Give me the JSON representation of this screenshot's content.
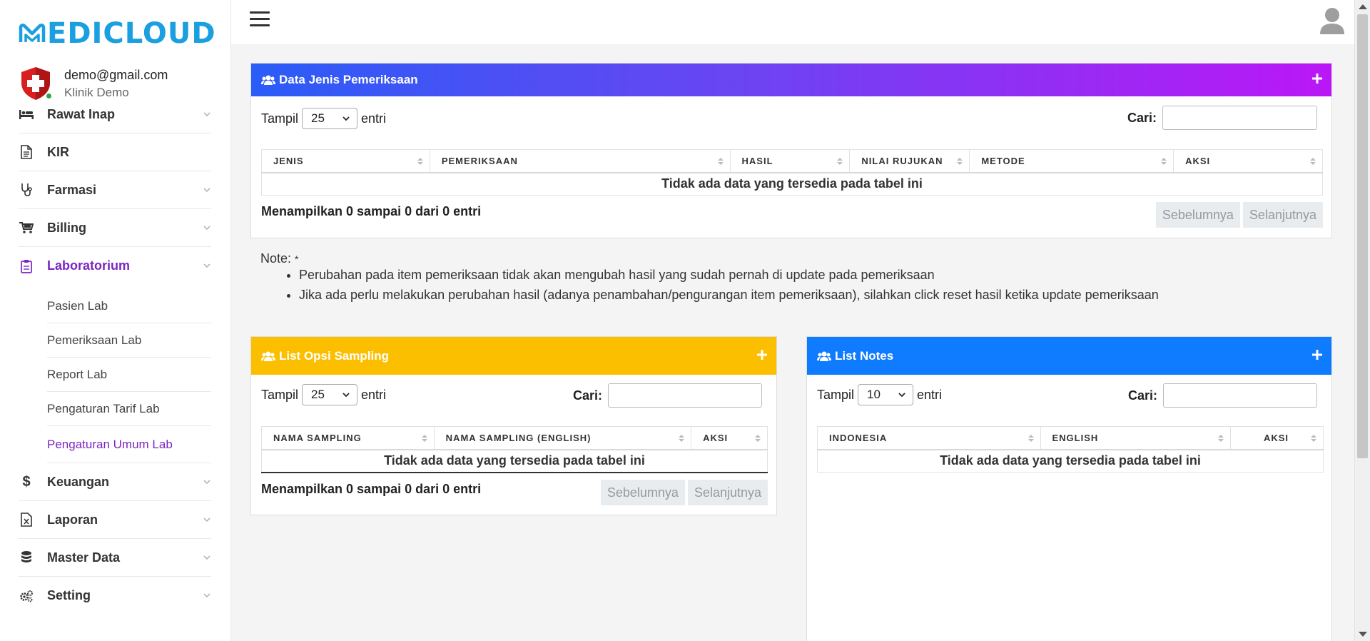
{
  "brand": {
    "logo_text": "EDICLOUD",
    "color": "#1a9fe0"
  },
  "user": {
    "email": "demo@gmail.com",
    "clinic": "Klinik Demo"
  },
  "sidebar": {
    "items": [
      {
        "label": "Rawat Inap",
        "icon": "bed-icon"
      },
      {
        "label": "KIR",
        "icon": "document-icon"
      },
      {
        "label": "Farmasi",
        "icon": "stethoscope-icon"
      },
      {
        "label": "Billing",
        "icon": "cart-icon"
      },
      {
        "label": "Laboratorium",
        "icon": "clipboard-icon"
      },
      {
        "label": "Keuangan",
        "icon": "dollar-icon"
      },
      {
        "label": "Laporan",
        "icon": "excel-file-icon"
      },
      {
        "label": "Master Data",
        "icon": "database-icon"
      },
      {
        "label": "Setting",
        "icon": "gears-icon"
      }
    ],
    "lab_submenu": [
      "Pasien Lab",
      "Pemeriksaan Lab",
      "Report Lab",
      "Pengaturan Tarif Lab",
      "Pengaturan Umum Lab"
    ],
    "active_color": "#7a26c1"
  },
  "jenis_card": {
    "title": "Data Jenis Pemeriksaan",
    "show_label": "Tampil",
    "show_value": "25",
    "entries_label": "entri",
    "search_label": "Cari:",
    "columns": [
      "JENIS",
      "PEMERIKSAAN",
      "HASIL",
      "NILAI RUJUKAN",
      "METODE",
      "AKSI"
    ],
    "empty_text": "Tidak ada data yang tersedia pada tabel ini",
    "info": "Menampilkan 0 sampai 0 dari 0 entri",
    "prev": "Sebelumnya",
    "next": "Selanjutnya"
  },
  "note": {
    "title": "Note:",
    "star": "*",
    "items": [
      "Perubahan pada item pemeriksaan tidak akan mengubah hasil yang sudah pernah di update pada pemeriksaan",
      "Jika ada perlu melakukan perubahan hasil (adanya penambahan/pengurangan item pemeriksaan), silahkan click reset hasil ketika update pemeriksaan"
    ]
  },
  "sampling_card": {
    "title": "List Opsi Sampling",
    "show_label": "Tampil",
    "show_value": "25",
    "entries_label": "entri",
    "search_label": "Cari:",
    "columns": [
      "NAMA SAMPLING",
      "NAMA SAMPLING (ENGLISH)",
      "AKSI"
    ],
    "empty_text": "Tidak ada data yang tersedia pada tabel ini",
    "info": "Menampilkan 0 sampai 0 dari 0 entri",
    "prev": "Sebelumnya",
    "next": "Selanjutnya"
  },
  "notes_card": {
    "title": "List Notes",
    "show_label": "Tampil",
    "show_value": "10",
    "entries_label": "entri",
    "search_label": "Cari:",
    "columns": [
      "INDONESIA",
      "ENGLISH",
      "AKSI"
    ],
    "empty_text": "Tidak ada data yang tersedia pada tabel ini"
  }
}
